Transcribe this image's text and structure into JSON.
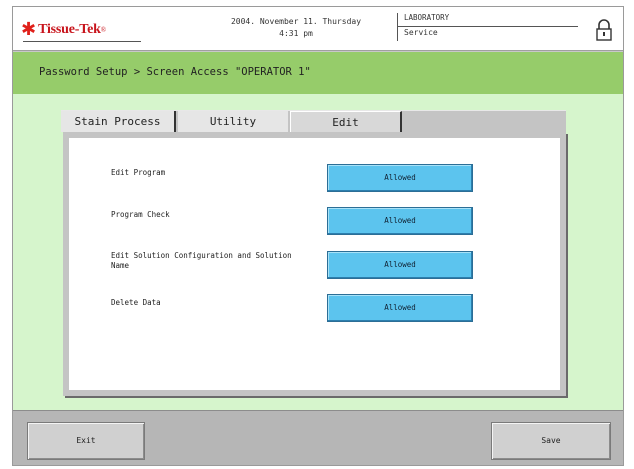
{
  "header": {
    "logo_star": "✱",
    "logo_text": "Tissue-Tek",
    "logo_mark": "®",
    "date": "2004. November 11. Thursday",
    "time": "4:31 pm",
    "mode_top": "LABORATORY",
    "mode_bottom": "Service",
    "lock_icon": "lock-icon"
  },
  "title": {
    "text": "Password Setup > Screen Access  \"OPERATOR 1\""
  },
  "tabs": [
    {
      "label": "Stain Process",
      "active": false
    },
    {
      "label": "Utility",
      "active": false
    },
    {
      "label": "Edit",
      "active": true
    }
  ],
  "rows": [
    {
      "label": "Edit Program",
      "value": "Allowed"
    },
    {
      "label": "Program Check",
      "value": "Allowed"
    },
    {
      "label": "Edit Solution Configuration and Solution Name",
      "value": "Allowed"
    },
    {
      "label": "Delete Data",
      "value": "Allowed"
    }
  ],
  "footer": {
    "exit_label": "Exit",
    "save_label": "Save"
  },
  "colors": {
    "accent_green": "#96cc6a",
    "background_green": "#d6f5cc",
    "button_blue": "#5cc4ee",
    "logo_red": "#c8141c"
  }
}
